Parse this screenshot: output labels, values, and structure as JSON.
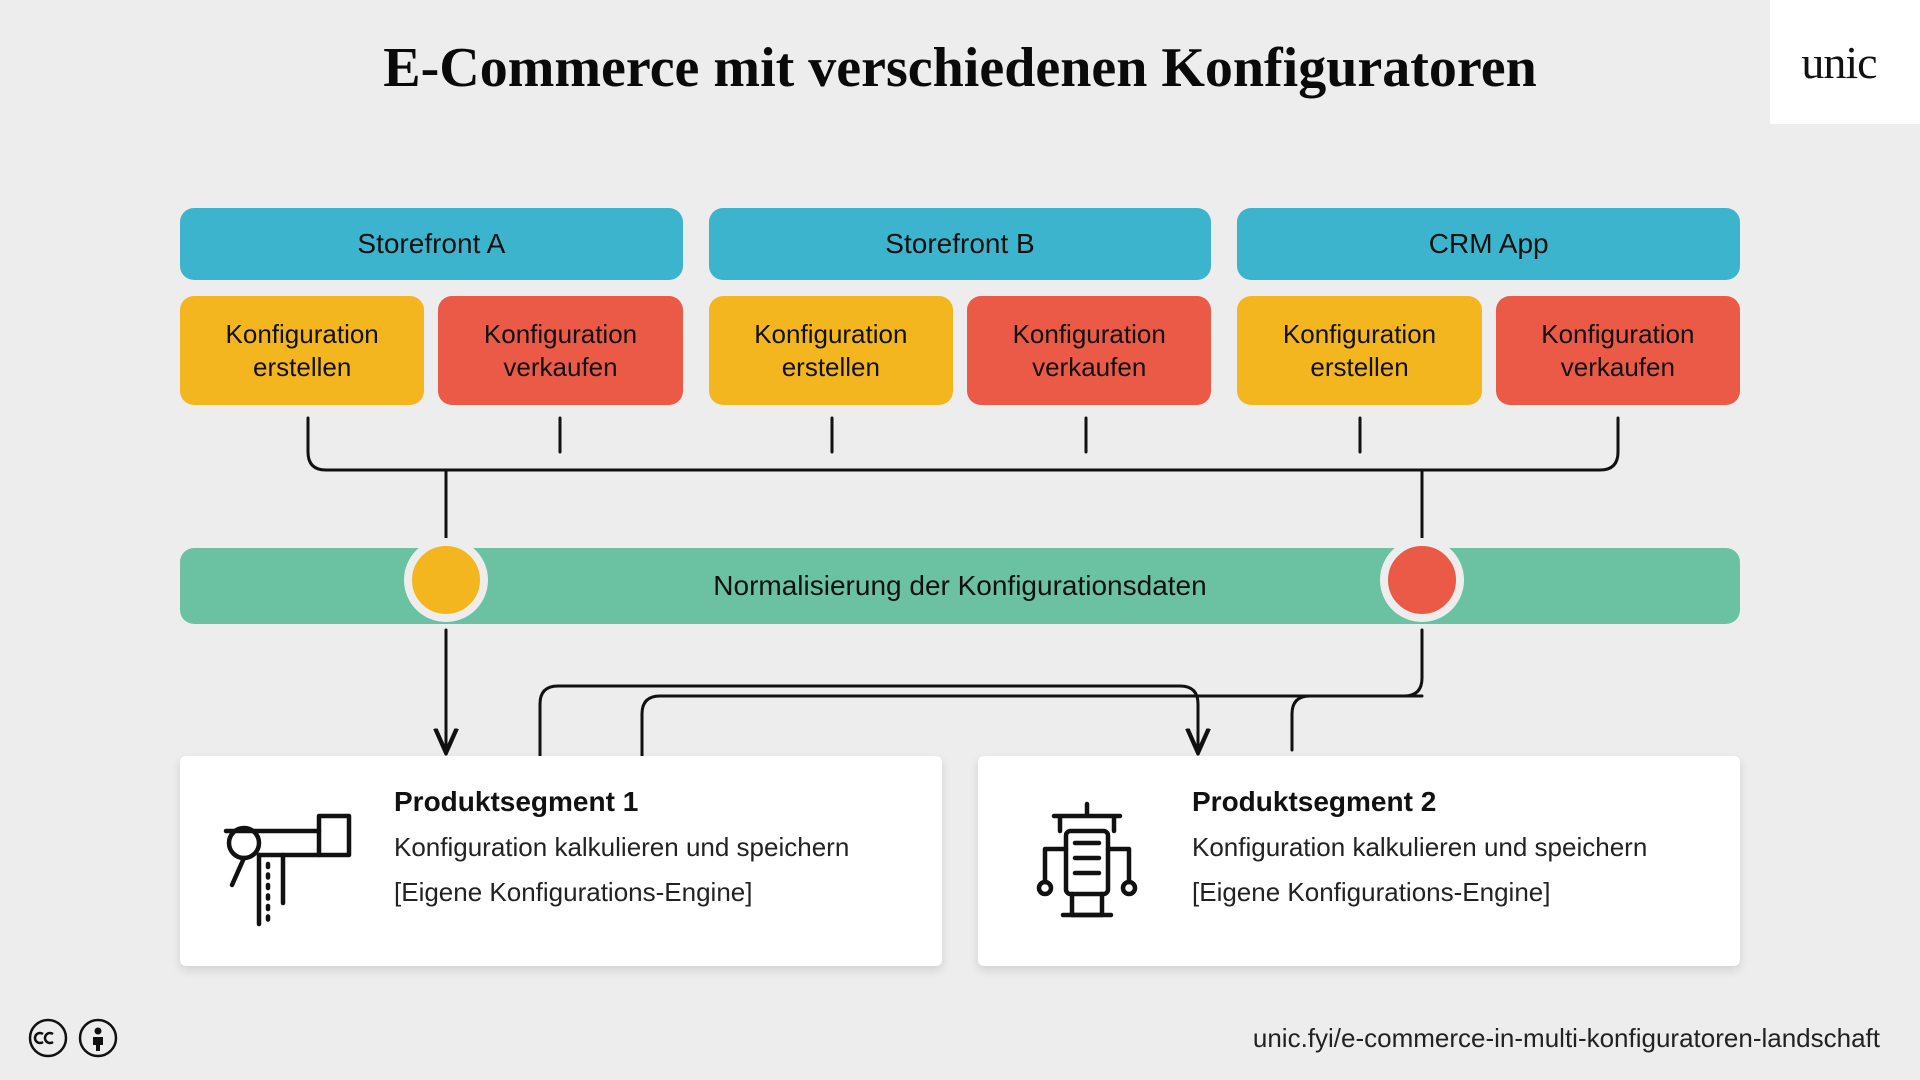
{
  "title": "E-Commerce mit verschiedenen Konfiguratoren",
  "logo": "unic",
  "storefronts": [
    "Storefront A",
    "Storefront B",
    "CRM App"
  ],
  "actions": {
    "create": "Konfiguration erstellen",
    "sell": "Konfiguration verkaufen"
  },
  "normalization": "Normalisierung der Konfigurationsdaten",
  "segments": [
    {
      "title": "Produktsegment 1",
      "desc": "Konfiguration kalkulieren und speichern",
      "note": "[Eigene Konfigurations-Engine]"
    },
    {
      "title": "Produktsegment 2",
      "desc": "Konfiguration kalkulieren und speichern",
      "note": "[Eigene Konfigurations-Engine]"
    }
  ],
  "footer_url": "unic.fyi/e-commerce-in-multi-konfiguratoren-landschaft"
}
